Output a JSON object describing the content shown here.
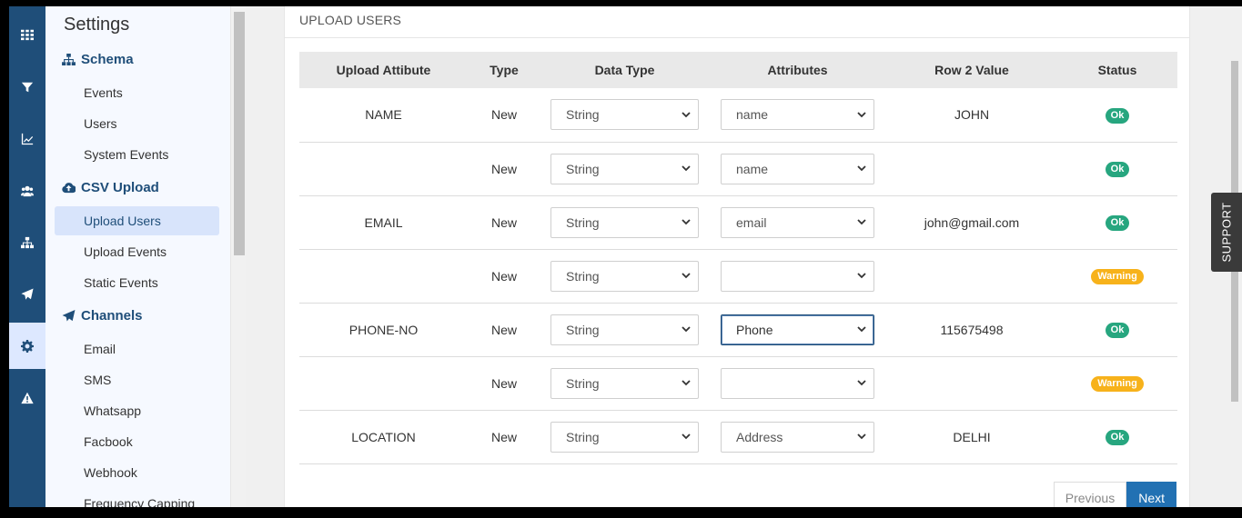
{
  "rail": {
    "icons": [
      "grid-icon",
      "filter-icon",
      "chart-line-icon",
      "users-icon",
      "sitemap-icon",
      "paper-plane-icon",
      "gear-icon",
      "warning-icon"
    ],
    "active_index": 6
  },
  "sidebar": {
    "title": "Settings",
    "sections": {
      "schema": {
        "label": "Schema",
        "items": [
          "Events",
          "Users",
          "System Events"
        ]
      },
      "csv": {
        "label": "CSV Upload",
        "items": [
          "Upload Users",
          "Upload Events",
          "Static Events"
        ]
      },
      "channels": {
        "label": "Channels",
        "items": [
          "Email",
          "SMS",
          "Whatsapp",
          "Facbook",
          "Webhook",
          "Frequency Capping"
        ]
      }
    },
    "active_item": "Upload Users"
  },
  "main": {
    "card_title": "UPLOAD USERS",
    "table": {
      "headers": [
        "Upload Attibute",
        "Type",
        "Data Type",
        "Attributes",
        "Row 2 Value",
        "Status"
      ],
      "rows": [
        {
          "attribute": "NAME",
          "type": "New",
          "data_type": "String",
          "attr": "name",
          "value": "JOHN",
          "status": "Ok"
        },
        {
          "attribute": "",
          "type": "New",
          "data_type": "String",
          "attr": "name",
          "value": "",
          "status": "Ok"
        },
        {
          "attribute": "EMAIL",
          "type": "New",
          "data_type": "String",
          "attr": "email",
          "value": "john@gmail.com",
          "status": "Ok"
        },
        {
          "attribute": "",
          "type": "New",
          "data_type": "String",
          "attr": "",
          "value": "",
          "status": "Warning"
        },
        {
          "attribute": "PHONE-NO",
          "type": "New",
          "data_type": "String",
          "attr": "Phone",
          "value": "115675498",
          "status": "Ok"
        },
        {
          "attribute": "",
          "type": "New",
          "data_type": "String",
          "attr": "",
          "value": "",
          "status": "Warning"
        },
        {
          "attribute": "LOCATION",
          "type": "New",
          "data_type": "String",
          "attr": "Address",
          "value": "DELHI",
          "status": "Ok"
        }
      ]
    },
    "pager": {
      "previous": "Previous",
      "next": "Next"
    }
  },
  "support": {
    "label": "SUPPORT"
  },
  "colors": {
    "brand": "#1f4e79",
    "ok": "#27a67f",
    "warning": "#f7b21b",
    "next": "#2271b3"
  }
}
